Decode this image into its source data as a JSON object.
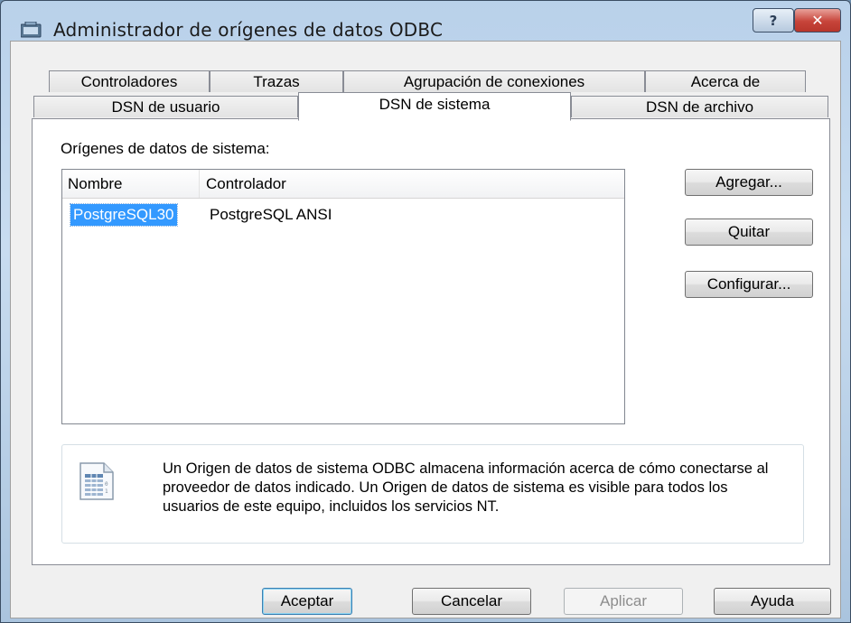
{
  "window": {
    "title": "Administrador de orígenes de datos ODBC",
    "help_label": "?",
    "close_label": "✕"
  },
  "tabs": {
    "row1": [
      "Controladores",
      "Trazas",
      "Agrupación de conexiones",
      "Acerca de"
    ],
    "row2": [
      "DSN de usuario",
      "DSN de sistema",
      "DSN de archivo"
    ],
    "active": "DSN de sistema"
  },
  "panel": {
    "group_label": "Orígenes de datos de sistema:",
    "columns": [
      "Nombre",
      "Controlador"
    ],
    "rows": [
      {
        "name": "PostgreSQL30",
        "driver": "PostgreSQL ANSI",
        "selected": true
      }
    ],
    "buttons": {
      "add": "Agregar...",
      "remove": "Quitar",
      "configure": "Configurar..."
    },
    "info_text": "Un Origen de datos de sistema ODBC almacena información acerca de cómo conectarse al proveedor de datos indicado. Un Origen de datos de sistema es visible para todos los usuarios de este equipo, incluidos los servicios NT.",
    "info_icon": "data-source-icon"
  },
  "footer": {
    "ok": "Aceptar",
    "cancel": "Cancelar",
    "apply": "Aplicar",
    "help": "Ayuda"
  },
  "colors": {
    "selection": "#3399ff",
    "close_button": "#c7443a",
    "title_bar": "#b9d1ea"
  }
}
